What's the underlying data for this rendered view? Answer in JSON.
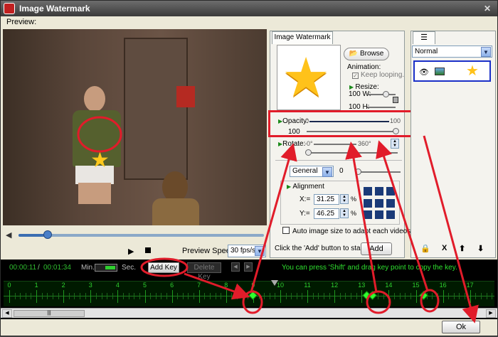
{
  "window": {
    "title": "Image Watermark",
    "close_glyph": "✕"
  },
  "preview": {
    "label": "Preview:",
    "speed_label": "Preview Speed:",
    "speed_value": "30 fps/s",
    "seek_progress": 0.12
  },
  "watermark_panel": {
    "tab_label": "Image Watermark",
    "browse_label": "Browse",
    "animation_label": "Animation:",
    "keep_looping_label": "Keep looping.",
    "resize_label": "Resize:",
    "width_label": "100  W:",
    "height_label": "100  H:",
    "opacity_label": "Opacity:",
    "opacity_min": "0",
    "opacity_max": "100",
    "opacity_value": "100",
    "rotate_label": "Rotate:",
    "rotate_min": "-0°",
    "rotate_max": "360°",
    "rotate_value": "0",
    "effect_select": "General",
    "effect_value": "0",
    "alignment_label": "Alignment",
    "x_label": "X:=",
    "x_value": "31.25",
    "y_label": "Y:=",
    "y_value": "46.25",
    "percent": "%",
    "auto_image_label": "Auto image size to adapt each videos.",
    "click_hint": "Click the 'Add' button to start ->",
    "add_label": "Add"
  },
  "layers_panel": {
    "blend_mode": "Normal",
    "tool_labels": [
      "X"
    ]
  },
  "timeline": {
    "current_time": "00:00:11",
    "time_separator": "/",
    "total_time": "00:01:34",
    "min_label": "Min.",
    "sec_label": "Sec.",
    "add_key_label": "Add Key",
    "delete_key_label": "Delete Key",
    "shift_hint": "You can press 'Shift' and drag key point to copy the key.",
    "ruler_labels": [
      "0",
      "1",
      "2",
      "3",
      "4",
      "5",
      "6",
      "7",
      "8",
      "9",
      "10",
      "11",
      "12",
      "13",
      "14",
      "15",
      "16",
      "17"
    ],
    "keyframes_seconds": [
      9.0,
      13.2,
      13.4,
      15.3
    ],
    "playhead_seconds": 9.8
  },
  "ok_label": "Ok",
  "colors": {
    "annotation_red": "#e11c2a",
    "timeline_green": "#2fd02f",
    "star_yellow": "#ffc21a"
  }
}
